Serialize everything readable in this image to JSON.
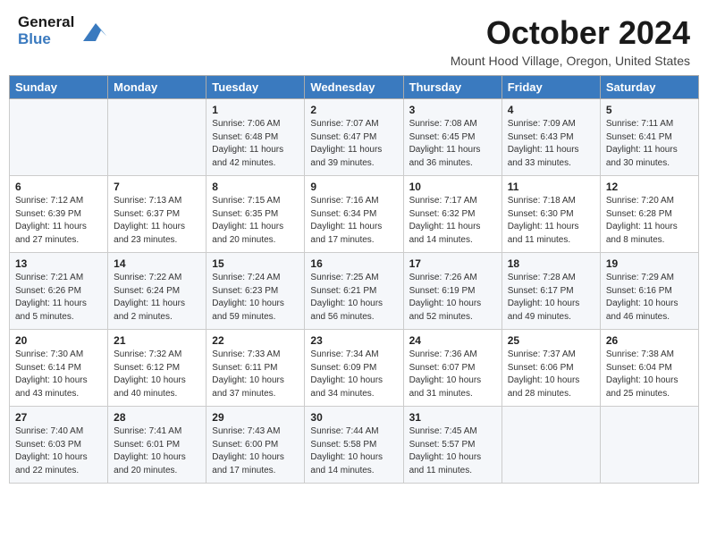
{
  "header": {
    "logo_general": "General",
    "logo_blue": "Blue",
    "month_title": "October 2024",
    "location": "Mount Hood Village, Oregon, United States"
  },
  "calendar": {
    "days_of_week": [
      "Sunday",
      "Monday",
      "Tuesday",
      "Wednesday",
      "Thursday",
      "Friday",
      "Saturday"
    ],
    "weeks": [
      [
        {
          "day": "",
          "info": ""
        },
        {
          "day": "",
          "info": ""
        },
        {
          "day": "1",
          "info": "Sunrise: 7:06 AM\nSunset: 6:48 PM\nDaylight: 11 hours and 42 minutes."
        },
        {
          "day": "2",
          "info": "Sunrise: 7:07 AM\nSunset: 6:47 PM\nDaylight: 11 hours and 39 minutes."
        },
        {
          "day": "3",
          "info": "Sunrise: 7:08 AM\nSunset: 6:45 PM\nDaylight: 11 hours and 36 minutes."
        },
        {
          "day": "4",
          "info": "Sunrise: 7:09 AM\nSunset: 6:43 PM\nDaylight: 11 hours and 33 minutes."
        },
        {
          "day": "5",
          "info": "Sunrise: 7:11 AM\nSunset: 6:41 PM\nDaylight: 11 hours and 30 minutes."
        }
      ],
      [
        {
          "day": "6",
          "info": "Sunrise: 7:12 AM\nSunset: 6:39 PM\nDaylight: 11 hours and 27 minutes."
        },
        {
          "day": "7",
          "info": "Sunrise: 7:13 AM\nSunset: 6:37 PM\nDaylight: 11 hours and 23 minutes."
        },
        {
          "day": "8",
          "info": "Sunrise: 7:15 AM\nSunset: 6:35 PM\nDaylight: 11 hours and 20 minutes."
        },
        {
          "day": "9",
          "info": "Sunrise: 7:16 AM\nSunset: 6:34 PM\nDaylight: 11 hours and 17 minutes."
        },
        {
          "day": "10",
          "info": "Sunrise: 7:17 AM\nSunset: 6:32 PM\nDaylight: 11 hours and 14 minutes."
        },
        {
          "day": "11",
          "info": "Sunrise: 7:18 AM\nSunset: 6:30 PM\nDaylight: 11 hours and 11 minutes."
        },
        {
          "day": "12",
          "info": "Sunrise: 7:20 AM\nSunset: 6:28 PM\nDaylight: 11 hours and 8 minutes."
        }
      ],
      [
        {
          "day": "13",
          "info": "Sunrise: 7:21 AM\nSunset: 6:26 PM\nDaylight: 11 hours and 5 minutes."
        },
        {
          "day": "14",
          "info": "Sunrise: 7:22 AM\nSunset: 6:24 PM\nDaylight: 11 hours and 2 minutes."
        },
        {
          "day": "15",
          "info": "Sunrise: 7:24 AM\nSunset: 6:23 PM\nDaylight: 10 hours and 59 minutes."
        },
        {
          "day": "16",
          "info": "Sunrise: 7:25 AM\nSunset: 6:21 PM\nDaylight: 10 hours and 56 minutes."
        },
        {
          "day": "17",
          "info": "Sunrise: 7:26 AM\nSunset: 6:19 PM\nDaylight: 10 hours and 52 minutes."
        },
        {
          "day": "18",
          "info": "Sunrise: 7:28 AM\nSunset: 6:17 PM\nDaylight: 10 hours and 49 minutes."
        },
        {
          "day": "19",
          "info": "Sunrise: 7:29 AM\nSunset: 6:16 PM\nDaylight: 10 hours and 46 minutes."
        }
      ],
      [
        {
          "day": "20",
          "info": "Sunrise: 7:30 AM\nSunset: 6:14 PM\nDaylight: 10 hours and 43 minutes."
        },
        {
          "day": "21",
          "info": "Sunrise: 7:32 AM\nSunset: 6:12 PM\nDaylight: 10 hours and 40 minutes."
        },
        {
          "day": "22",
          "info": "Sunrise: 7:33 AM\nSunset: 6:11 PM\nDaylight: 10 hours and 37 minutes."
        },
        {
          "day": "23",
          "info": "Sunrise: 7:34 AM\nSunset: 6:09 PM\nDaylight: 10 hours and 34 minutes."
        },
        {
          "day": "24",
          "info": "Sunrise: 7:36 AM\nSunset: 6:07 PM\nDaylight: 10 hours and 31 minutes."
        },
        {
          "day": "25",
          "info": "Sunrise: 7:37 AM\nSunset: 6:06 PM\nDaylight: 10 hours and 28 minutes."
        },
        {
          "day": "26",
          "info": "Sunrise: 7:38 AM\nSunset: 6:04 PM\nDaylight: 10 hours and 25 minutes."
        }
      ],
      [
        {
          "day": "27",
          "info": "Sunrise: 7:40 AM\nSunset: 6:03 PM\nDaylight: 10 hours and 22 minutes."
        },
        {
          "day": "28",
          "info": "Sunrise: 7:41 AM\nSunset: 6:01 PM\nDaylight: 10 hours and 20 minutes."
        },
        {
          "day": "29",
          "info": "Sunrise: 7:43 AM\nSunset: 6:00 PM\nDaylight: 10 hours and 17 minutes."
        },
        {
          "day": "30",
          "info": "Sunrise: 7:44 AM\nSunset: 5:58 PM\nDaylight: 10 hours and 14 minutes."
        },
        {
          "day": "31",
          "info": "Sunrise: 7:45 AM\nSunset: 5:57 PM\nDaylight: 10 hours and 11 minutes."
        },
        {
          "day": "",
          "info": ""
        },
        {
          "day": "",
          "info": ""
        }
      ]
    ]
  }
}
